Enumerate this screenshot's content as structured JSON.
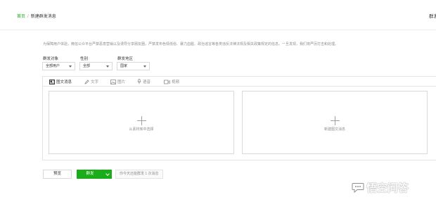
{
  "breadcrumb": {
    "home": "首页",
    "separator": "/",
    "current": "新建群发消息"
  },
  "header_right": "群发",
  "notice": "为保障用户体验，微信公众平台严禁恶意营销以及诱导分享朋友圈，严禁发布色情低俗、暴力血腥、政治谣言等各类违反法律法规及相关政策规定的信息。一旦发现，我们将严厉打击和处理。",
  "filters": {
    "target": {
      "label": "群发对象",
      "value": "全部用户"
    },
    "gender": {
      "label": "性别",
      "value": "全部"
    },
    "region": {
      "label": "群发地区",
      "value": "国家"
    }
  },
  "tabs": [
    {
      "label": "图文消息",
      "icon": "article-icon",
      "active": true
    },
    {
      "label": "文字",
      "icon": "pencil-icon",
      "active": false
    },
    {
      "label": "图片",
      "icon": "image-icon",
      "active": false
    },
    {
      "label": "语音",
      "icon": "microphone-icon",
      "active": false
    },
    {
      "label": "视频",
      "icon": "video-icon",
      "active": false
    }
  ],
  "cards": {
    "from_library": "从素材库中选择",
    "new_article": "新建图文消息"
  },
  "actions": {
    "preview": "预览",
    "send": "群发",
    "quota": "你今天还能群发 1 次消息"
  },
  "watermark": "悟空问答",
  "colors": {
    "accent": "#1aad19",
    "muted": "#8d8d8d",
    "border": "#d9d9d9"
  }
}
